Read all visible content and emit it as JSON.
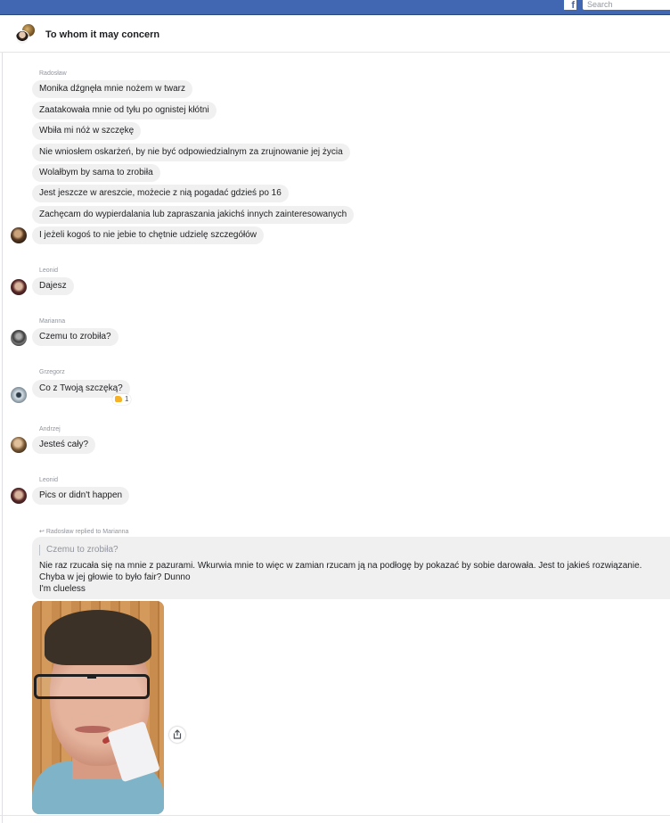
{
  "topbar": {
    "logo_glyph": "f",
    "search_placeholder": "Search"
  },
  "conversation": {
    "title": "To whom it may concern"
  },
  "groups": [
    {
      "sender": "Radosław",
      "messages": [
        "Monika dźgnęła mnie nożem w twarz",
        "Zaatakowała mnie od tyłu po ognistej kłótni",
        "Wbiła mi nóż w szczękę",
        "Nie wniosłem oskarżeń, by nie być odpowiedzialnym za zrujnowanie jej życia",
        "Wolałbym by sama to zrobiła",
        "Jest jeszcze w areszcie, możecie z nią pogadać gdzieś po 16",
        "Zachęcam do wypierdalania lub zapraszania jakichś innych zainteresowanych",
        "I jeżeli kogoś to nie jebie to chętnie udzielę szczegółów"
      ]
    },
    {
      "sender": "Leonid",
      "messages": [
        "Dajesz"
      ]
    },
    {
      "sender": "Marianna",
      "messages": [
        "Czemu to zrobiła?"
      ]
    },
    {
      "sender": "Grzegorz",
      "messages": [
        "Co z Twoją szczęką?"
      ],
      "reaction": {
        "icon": "thumbs-up-icon",
        "count": "1"
      }
    },
    {
      "sender": "Andrzej",
      "messages": [
        "Jesteś cały?"
      ]
    },
    {
      "sender": "Leonid",
      "messages": [
        "Pics or didn't happen"
      ]
    }
  ],
  "reply": {
    "meta": "Radosław replied to Marianna",
    "quoted": "Czemu to zrobiła?",
    "lines": [
      "Nie raz rzucała się na mnie z pazurami. Wkurwia mnie to więc w zamian rzucam ją na podłogę by pokazać by sobie darowała. Jest to jakieś rozwiązanie.",
      "Chyba w jej głowie to było fair? Dunno",
      "I'm clueless"
    ]
  },
  "colors": {
    "topbar": "#4267b2",
    "bubble": "#f1f0f0",
    "meta": "#90949c"
  }
}
